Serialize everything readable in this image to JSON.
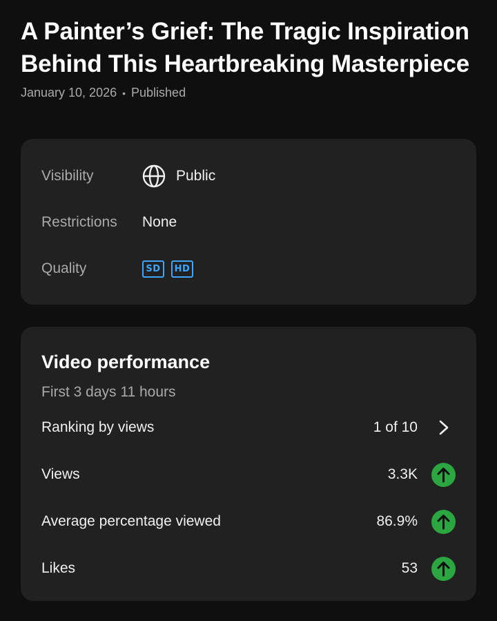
{
  "video": {
    "title": "A Painter’s Grief: The Tragic Inspiration Behind This Heartbreaking Masterpiece",
    "date": "January 10, 2026",
    "separator": "•",
    "status": "Published"
  },
  "details": {
    "visibility": {
      "label": "Visibility",
      "value": "Public",
      "icon": "globe-icon"
    },
    "restrictions": {
      "label": "Restrictions",
      "value": "None"
    },
    "quality": {
      "label": "Quality",
      "badges": [
        "SD",
        "HD"
      ]
    }
  },
  "performance": {
    "title": "Video performance",
    "period": "First 3 days 11 hours",
    "ranking": {
      "label": "Ranking by views",
      "value": "1 of 10",
      "icon": "chevron-right-icon"
    },
    "metrics": [
      {
        "label": "Views",
        "value": "3.3K",
        "trend": "up"
      },
      {
        "label": "Average percentage viewed",
        "value": "86.9%",
        "trend": "up"
      },
      {
        "label": "Likes",
        "value": "53",
        "trend": "up"
      }
    ]
  },
  "colors": {
    "background": "#0f0f0f",
    "card": "#212121",
    "accent_blue": "#3ea6ff",
    "trend_up_green": "#2ba640"
  }
}
